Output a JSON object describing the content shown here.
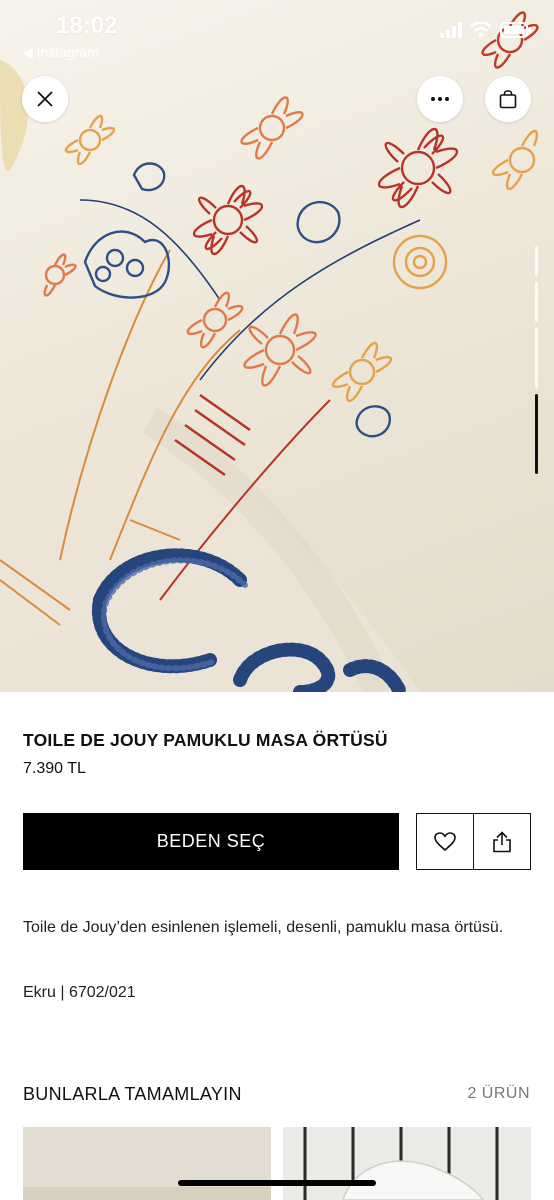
{
  "status_bar": {
    "time": "18:02",
    "back_app": "◀ Instagram",
    "icons": [
      "signal-icon",
      "wifi-icon",
      "battery-icon"
    ]
  },
  "hero": {
    "buttons": {
      "close_icon": "close-icon",
      "more_icon": "more-icon",
      "bag_icon": "shopping-bag-icon"
    }
  },
  "product": {
    "title": "TOILE DE JOUY PAMUKLU MASA ÖRTÜSÜ",
    "price": "7.390 TL",
    "size_button": "BEDEN SEÇ",
    "description": "Toile de Jouy’den esinlenen işlemeli, desenli, pamuklu masa örtüsü.",
    "color_code": "Ekru | 6702/021"
  },
  "complete_look": {
    "title": "BUNLARLA TAMAMLAYIN",
    "count": "2 ÜRÜN"
  },
  "colors": {
    "primary": "#000000",
    "background": "#ffffff",
    "muted": "#777777"
  }
}
